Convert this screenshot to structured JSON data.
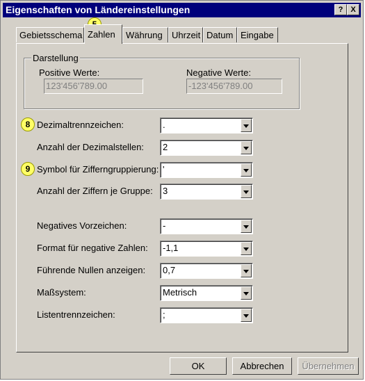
{
  "window": {
    "title": "Eigenschaften von Ländereinstellungen",
    "help_label": "?",
    "close_label": "X"
  },
  "tabs": [
    {
      "label": "Gebietsschema"
    },
    {
      "label": "Zahlen",
      "active": true
    },
    {
      "label": "Währung"
    },
    {
      "label": "Uhrzeit"
    },
    {
      "label": "Datum"
    },
    {
      "label": "Eingabe"
    }
  ],
  "callouts": {
    "tab": "5",
    "decimal": "8",
    "grouping": "9"
  },
  "darstellung": {
    "legend": "Darstellung",
    "positive_label": "Positive Werte:",
    "positive_value": "123'456'789.00",
    "negative_label": "Negative Werte:",
    "negative_value": "-123'456'789.00"
  },
  "fields": [
    {
      "label": "Dezimaltrennzeichen:",
      "value": "."
    },
    {
      "label": "Anzahl der Dezimalstellen:",
      "value": "2"
    },
    {
      "label": "Symbol für Zifferngruppierung:",
      "value": "'"
    },
    {
      "label": "Anzahl der Ziffern je Gruppe:",
      "value": "3"
    },
    {
      "label": "Negatives Vorzeichen:",
      "value": "-"
    },
    {
      "label": "Format für negative Zahlen:",
      "value": "-1,1"
    },
    {
      "label": "Führende Nullen anzeigen:",
      "value": "0,7"
    },
    {
      "label": "Maßsystem:",
      "value": "Metrisch"
    },
    {
      "label": "Listentrennzeichen:",
      "value": ";"
    }
  ],
  "buttons": {
    "ok": "OK",
    "cancel": "Abbrechen",
    "apply": "Übernehmen"
  }
}
